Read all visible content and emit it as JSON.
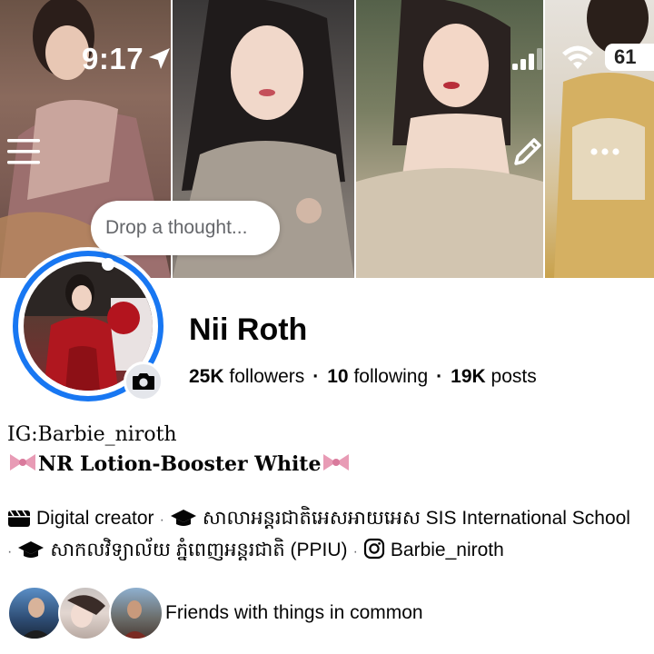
{
  "status_bar": {
    "time": "9:17",
    "battery": "61"
  },
  "cover": {
    "panels": 4
  },
  "thought_bubble": {
    "placeholder": "Drop a thought..."
  },
  "profile": {
    "name": "Nii Roth",
    "followers_count": "25K",
    "followers_label": "followers",
    "following_count": "10",
    "following_label": "following",
    "posts_count": "19K",
    "posts_label": "posts"
  },
  "bio": {
    "line1": "IG:Barbie_niroth",
    "line2": "NR Lotion-Booster White"
  },
  "details": {
    "category": "Digital creator",
    "school1": "សាលាអន្តរជាតិអេសអាយអេស SIS International School",
    "school2": "សាកលវិទ្យាល័យ ភ្នំពេញអន្តរជាតិ (PPIU)",
    "instagram": "Barbie_niroth"
  },
  "friends": {
    "label": "Friends with things in common"
  },
  "icons": {
    "menu": "hamburger-menu-icon",
    "edit": "pencil-icon",
    "more": "ellipsis-icon",
    "camera": "camera-icon",
    "category": "clapperboard-icon",
    "education": "graduation-cap-icon",
    "instagram": "instagram-icon",
    "location": "location-arrow-icon"
  },
  "colors": {
    "story_ring": "#1877f2",
    "text_primary": "#050505",
    "text_secondary": "#65676b",
    "bow": "#e89bb5"
  }
}
